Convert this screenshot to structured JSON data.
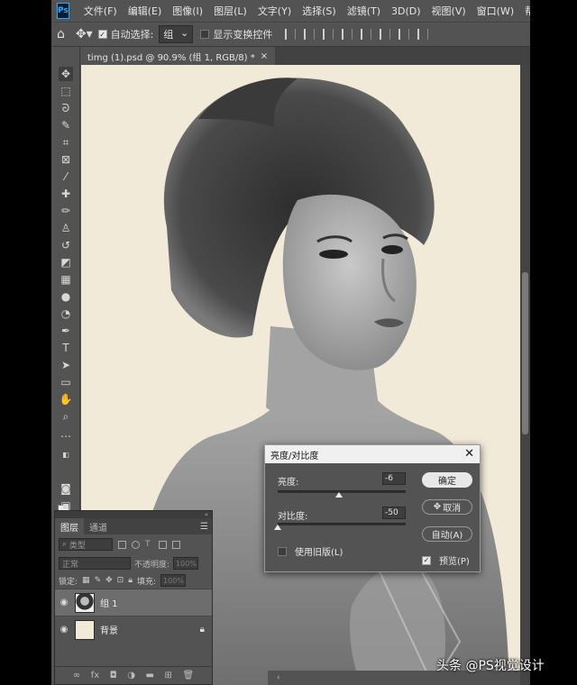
{
  "app": {
    "logo": "Ps",
    "menu": [
      "文件(F)",
      "编辑(E)",
      "图像(I)",
      "图层(L)",
      "文字(Y)",
      "选择(S)",
      "滤镜(T)",
      "3D(D)",
      "视图(V)",
      "窗口(W)",
      "帮助"
    ]
  },
  "options": {
    "auto_select_label": "自动选择:",
    "auto_select_value": "组",
    "show_transform_label": "显示变换控件"
  },
  "document": {
    "tab_title": "timg (1).psd @ 90.9% (组 1, RGB/8) *",
    "tab_close": "×"
  },
  "layers": {
    "panel_collapse": "«",
    "tabs": [
      "图层",
      "通道"
    ],
    "filter_placeholder": "类型",
    "blend_mode": "正常",
    "opacity_label": "不透明度:",
    "opacity_value": "100%",
    "lock_label": "锁定:",
    "fill_label": "填充:",
    "fill_value": "100%",
    "items": [
      {
        "name": "组 1",
        "selected": true
      },
      {
        "name": "背景",
        "selected": false
      }
    ]
  },
  "dialog": {
    "title": "亮度/对比度",
    "brightness_label": "亮度:",
    "brightness_value": "-6",
    "brightness_min": -150,
    "brightness_max": 150,
    "contrast_label": "对比度:",
    "contrast_value": "-50",
    "contrast_min": -50,
    "contrast_max": 100,
    "legacy_label": "使用旧版(L)",
    "legacy_checked": false,
    "ok_label": "确定",
    "cancel_label": "取消",
    "auto_label": "自动(A)",
    "preview_label": "预览(P)",
    "preview_checked": true
  },
  "watermark": "头条 @PS视觉设计",
  "colors": {
    "ui_bg": "#535353",
    "canvas_bg": "#f2ead8",
    "accent_blue": "#31a8ff"
  }
}
